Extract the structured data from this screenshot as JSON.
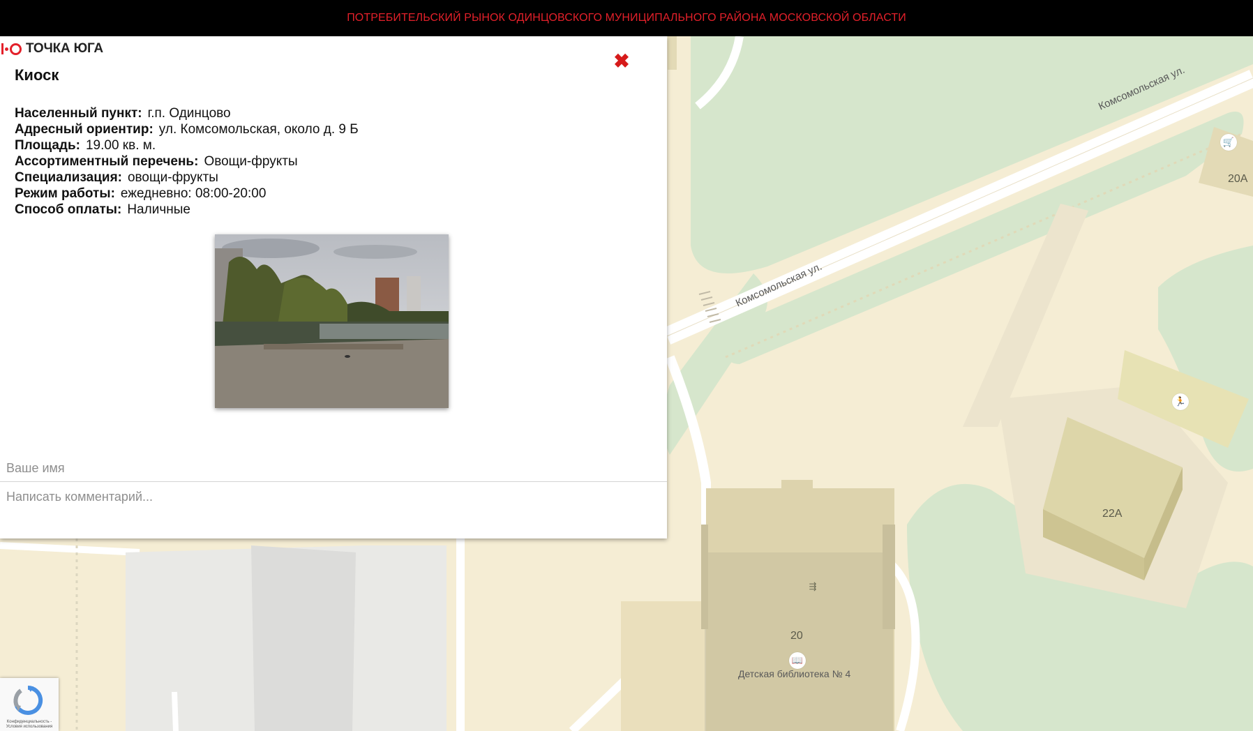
{
  "header": {
    "title": "ПОТРЕБИТЕЛЬСКИЙ РЫНОК ОДИНЦОВСКОГО МУНИЦИПАЛЬНОГО РАЙОНА МОСКОВСКОЙ ОБЛАСТИ"
  },
  "popup": {
    "logo_text": "ТОЧКА ЮГА",
    "close_icon": "✖",
    "kind": "Киоск",
    "fields": [
      {
        "key": "Населенный пункт:",
        "value": "г.п. Одинцово"
      },
      {
        "key": "Адресный ориентир:",
        "value": "ул. Комсомольская, около д. 9 Б"
      },
      {
        "key": "Площадь:",
        "value": "19.00 кв. м."
      },
      {
        "key": "Ассортиментный перечень:",
        "value": "Овощи-фрукты"
      },
      {
        "key": "Специализация:",
        "value": "овощи-фрукты"
      },
      {
        "key": "Режим работы:",
        "value": "ежедневно: 08:00-20:00"
      },
      {
        "key": "Способ оплаты:",
        "value": "Наличные"
      }
    ],
    "name_placeholder": "Ваше имя",
    "comment_placeholder": "Написать комментарий..."
  },
  "map": {
    "street_label_1": "Комсомольская ул.",
    "street_label_2": "Комсомольская ул.",
    "buildings": {
      "b20a": "20А",
      "b22a": "22А",
      "b20": "20"
    },
    "poi_library": "Детская библиотека № 4",
    "icons": [
      "shopping-cart-icon",
      "running-person-icon",
      "entrance-icon",
      "book-icon"
    ]
  },
  "recaptcha": {
    "text": "Конфиденциальность - Условия использования"
  },
  "colors": {
    "accent": "#e3202a",
    "topbar_bg": "#000000",
    "map_land": "#f5edd4",
    "map_green": "#d4e4c8"
  }
}
